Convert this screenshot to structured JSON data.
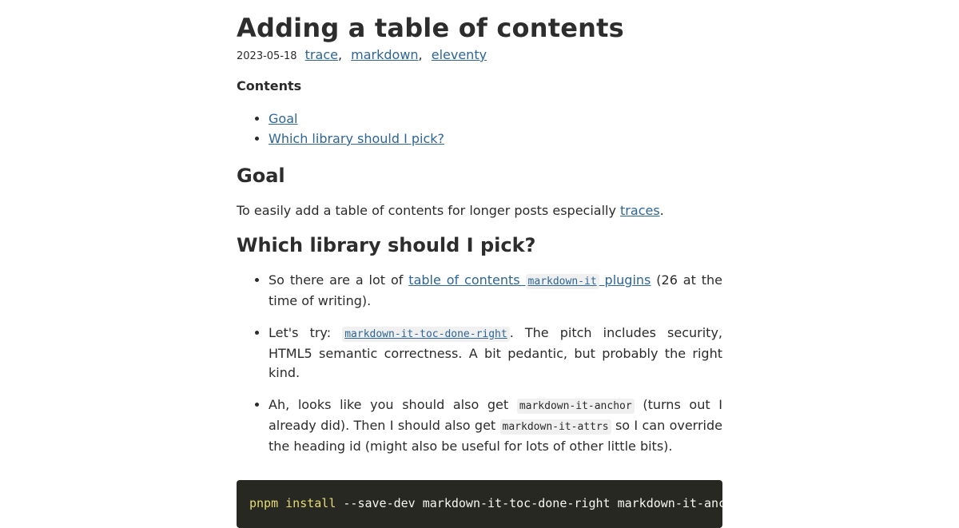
{
  "post": {
    "title": "Adding a table of contents",
    "date": "2023-05-18",
    "tags": [
      "trace",
      "markdown",
      "eleventy"
    ],
    "tag_separator": ","
  },
  "toc": {
    "heading": "Contents",
    "items": [
      "Goal",
      "Which library should I pick?"
    ]
  },
  "goal": {
    "heading": "Goal",
    "text_before": "To easily add a table of contents for longer posts especially ",
    "link": "traces",
    "text_after": "."
  },
  "library": {
    "heading": "Which library should I pick?",
    "items": [
      {
        "before": "So there are a lot of ",
        "link_a": "table of contents ",
        "link_code": "markdown-it",
        "link_b": " plugins",
        "after": " (26 at the time of writing)."
      },
      {
        "before": "Let's try: ",
        "link_code": "markdown-it-toc-done-right",
        "after": ". The pitch includes security, HTML5 semantic correctness. A bit pedantic, but probably the right kind."
      },
      {
        "before": "Ah, looks like you should also get ",
        "code1": "markdown-it-anchor",
        "middle": " (turns out I already did). Then I should also get ",
        "code2": "markdown-it-attrs",
        "after": " so I can override the heading id (might also be useful for lots of other little bits)."
      }
    ]
  },
  "code_block": {
    "command": "pnpm install",
    "args": " --save-dev markdown-it-toc-done-right markdown-it-anchor markdown-it-attrs"
  },
  "colors": {
    "link": "#2e6596",
    "code_bg": "#272822",
    "command": "#e6db74"
  }
}
